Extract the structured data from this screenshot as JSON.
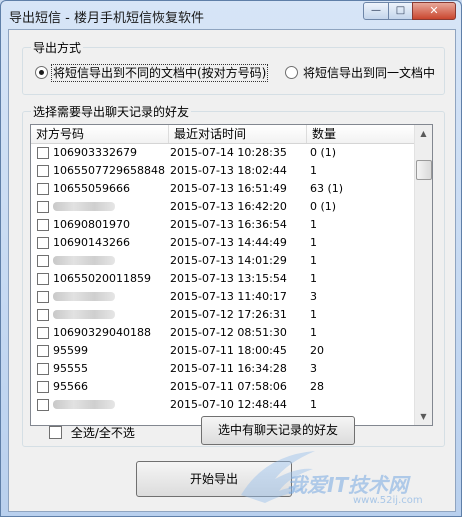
{
  "window": {
    "title": "导出短信 - 楼月手机短信恢复软件",
    "buttons": {
      "minimize": "—",
      "maximize": "□",
      "close": "✕"
    }
  },
  "export_mode": {
    "title": "导出方式",
    "option_separate": "将短信导出到不同的文档中(按对方号码)",
    "option_single": "将短信导出到同一文档中",
    "selected": "separate"
  },
  "friends": {
    "title": "选择需要导出聊天记录的好友",
    "columns": {
      "number": "对方号码",
      "time": "最近对话时间",
      "count": "数量"
    },
    "rows": [
      {
        "number": "106903332679",
        "time": "2015-07-14 10:28:35",
        "count": "0 (1)",
        "blurred": false
      },
      {
        "number": "1065507729658848",
        "time": "2015-07-13 18:02:44",
        "count": "1",
        "blurred": false
      },
      {
        "number": "10655059666",
        "time": "2015-07-13 16:51:49",
        "count": "63 (1)",
        "blurred": false
      },
      {
        "number": "",
        "time": "2015-07-13 16:42:20",
        "count": "0 (1)",
        "blurred": true
      },
      {
        "number": "10690801970",
        "time": "2015-07-13 16:36:54",
        "count": "1",
        "blurred": false
      },
      {
        "number": "10690143266",
        "time": "2015-07-13 14:44:49",
        "count": "1",
        "blurred": false
      },
      {
        "number": "",
        "time": "2015-07-13 14:01:29",
        "count": "1",
        "blurred": true
      },
      {
        "number": "10655020011859",
        "time": "2015-07-13 13:15:54",
        "count": "1",
        "blurred": false
      },
      {
        "number": "",
        "time": "2015-07-13 11:40:17",
        "count": "3",
        "blurred": true
      },
      {
        "number": "",
        "time": "2015-07-12 17:26:31",
        "count": "1",
        "blurred": true
      },
      {
        "number": "10690329040188",
        "time": "2015-07-12 08:51:30",
        "count": "1",
        "blurred": false
      },
      {
        "number": "95599",
        "time": "2015-07-11 18:00:45",
        "count": "20",
        "blurred": false
      },
      {
        "number": "95555",
        "time": "2015-07-11 16:34:28",
        "count": "3",
        "blurred": false
      },
      {
        "number": "95566",
        "time": "2015-07-11 07:58:06",
        "count": "28",
        "blurred": false
      },
      {
        "number": "",
        "time": "2015-07-10 12:48:44",
        "count": "1",
        "blurred": true
      }
    ],
    "select_all_label": "全选/全不选",
    "select_all_checked": false,
    "select_with_chat_label": "选中有聊天记录的好友"
  },
  "start_button_label": "开始导出",
  "watermark": {
    "main": "我爱IT技术网",
    "sub": "www.52ij.com"
  },
  "colors": {
    "window_frame": "#b9d0ee",
    "client_bg": "#f0f0f0",
    "close_button": "#c9462f"
  }
}
